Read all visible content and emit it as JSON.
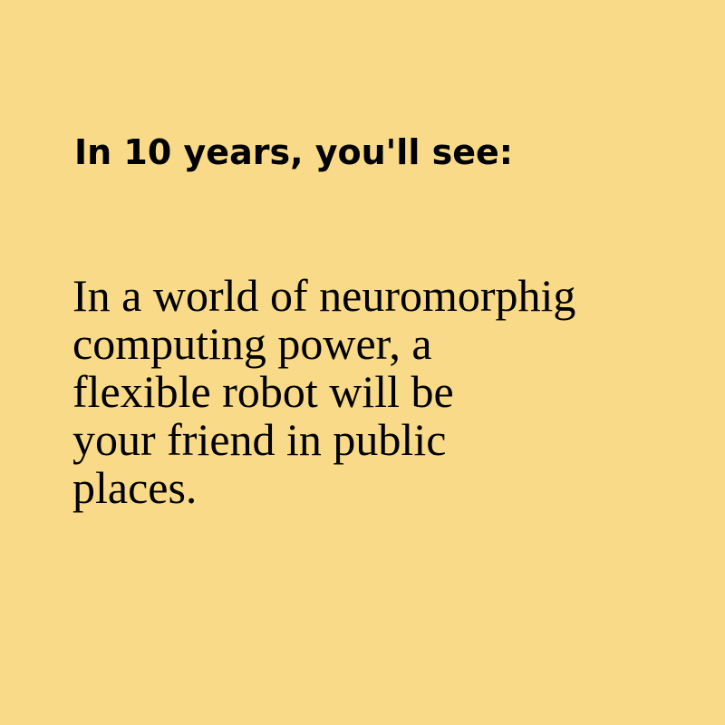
{
  "heading": "In 10 years, you'll see:",
  "body_lines": [
    "In a world of neuromorphig",
    "computing power, a",
    "flexible robot will be",
    "your friend in public",
    "places."
  ],
  "colors": {
    "background": "#f8da88",
    "text": "#000000"
  }
}
